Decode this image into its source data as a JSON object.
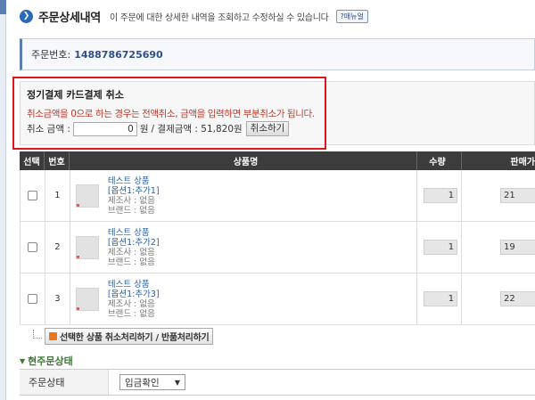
{
  "header": {
    "title": "주문상세내역",
    "description": "이 주문에 대한 상세한 내역을 조회하고 수정하실 수 있습니다",
    "manual_label": "?매뉴얼"
  },
  "order": {
    "label": "주문번호:",
    "number": "1488786725690"
  },
  "cancel_panel": {
    "title": "정기결제 카드결제 취소",
    "notice": "취소금액을 0으로 하는 경우는 전액취소, 금액을 입력하면 부분취소가 됩니다.",
    "amount_label": "취소 금액 :",
    "amount_value": "0",
    "won": "원",
    "payment_label": "/ 결제금액 : 51,820원",
    "cancel_button": "취소하기"
  },
  "table": {
    "headers": {
      "select": "선택",
      "no": "번호",
      "product": "상품명",
      "qty": "수량",
      "price": "판매가"
    },
    "rows": [
      {
        "no": "1",
        "name": "테스트 상품",
        "option": "[옵션1:추가1]",
        "maker": "제조사 : 없음",
        "brand": "브랜드 : 없음",
        "qty": "1",
        "price": "21"
      },
      {
        "no": "2",
        "name": "테스트 상품",
        "option": "[옵션1:추가2]",
        "maker": "제조사 : 없음",
        "brand": "브랜드 : 없음",
        "qty": "1",
        "price": "19"
      },
      {
        "no": "3",
        "name": "테스트 상품",
        "option": "[옵션1:추가3]",
        "maker": "제조사 : 없음",
        "brand": "브랜드 : 없음",
        "qty": "1",
        "price": "22"
      }
    ]
  },
  "bulk_action": {
    "label": "선택한 상품 취소처리하기 / 반품처리하기"
  },
  "status": {
    "section_title": "현주문상태",
    "label": "주문상태",
    "selected": "입금확인"
  },
  "colors": {
    "highlight": "#e2141b",
    "notice": "#c0392b",
    "link": "#2c5d9b",
    "section": "#3c7a2f"
  }
}
